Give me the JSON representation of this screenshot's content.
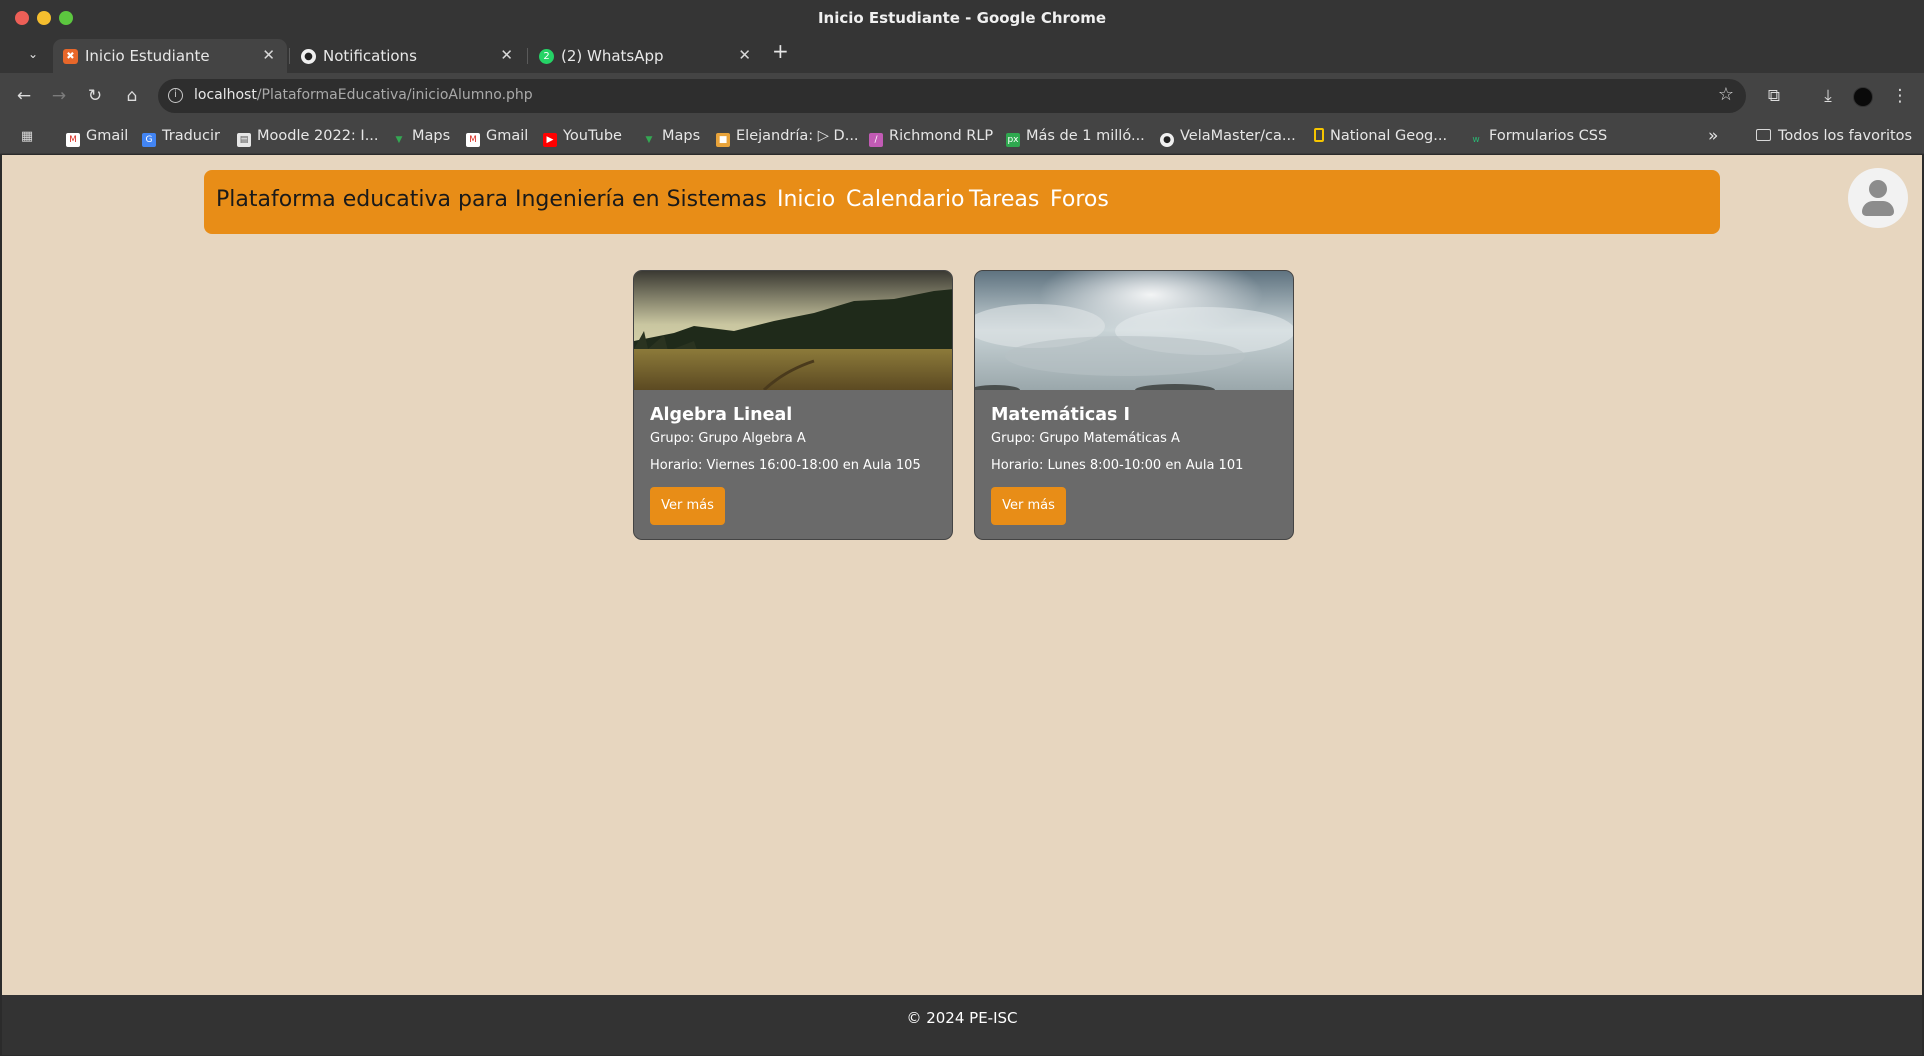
{
  "window": {
    "title": "Inicio Estudiante - Google Chrome"
  },
  "tabs": [
    {
      "label": "Inicio Estudiante",
      "active": true,
      "favicon": "xampp-icon"
    },
    {
      "label": "Notifications",
      "active": false,
      "favicon": "github-icon"
    },
    {
      "label": "(2) WhatsApp",
      "active": false,
      "favicon": "whatsapp-icon"
    }
  ],
  "toolbar": {
    "url_host": "localhost",
    "url_path": "/PlataformaEducativa/inicioAlumno.php"
  },
  "bookmarks": [
    {
      "label": "Gmail",
      "icon": "gmail-icon"
    },
    {
      "label": "Traducir",
      "icon": "translate-icon"
    },
    {
      "label": "Moodle 2022: I...",
      "icon": "moodle-icon"
    },
    {
      "label": "Maps",
      "icon": "maps-icon"
    },
    {
      "label": "Gmail",
      "icon": "gmail-icon"
    },
    {
      "label": "YouTube",
      "icon": "youtube-icon"
    },
    {
      "label": "Maps",
      "icon": "maps-icon"
    },
    {
      "label": "Elejandría: ▷ D...",
      "icon": "book-icon"
    },
    {
      "label": "Richmond RLP",
      "icon": "richmond-icon"
    },
    {
      "label": "Más de 1 milló...",
      "icon": "px-icon"
    },
    {
      "label": "VelaMaster/ca...",
      "icon": "github-icon"
    },
    {
      "label": "National Geog...",
      "icon": "natgeo-icon"
    },
    {
      "label": "Formularios CSS",
      "icon": "w-icon"
    }
  ],
  "bookmarks_all": "Todos los favoritos",
  "page": {
    "brand": "Plataforma educativa para Ingeniería en Sistemas",
    "nav": [
      "Inicio",
      "Calendario",
      "Tareas",
      "Foros"
    ],
    "courses": [
      {
        "title": "Algebra Lineal",
        "grupo": "Grupo: Grupo Algebra A",
        "horario": "Horario: Viernes 16:00-18:00 en Aula 105",
        "button": "Ver más"
      },
      {
        "title": "Matemáticas I",
        "grupo": "Grupo: Grupo Matemáticas A",
        "horario": "Horario: Lunes 8:00-10:00 en Aula 101",
        "button": "Ver más"
      }
    ],
    "footer": "© 2024 PE-ISC"
  },
  "colors": {
    "accent": "#e88d17",
    "background": "#e7d6bf",
    "card": "#6a6a6a",
    "footer": "#333333"
  }
}
